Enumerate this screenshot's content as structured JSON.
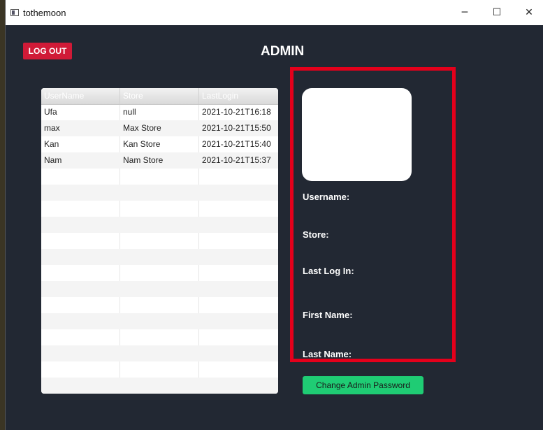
{
  "window": {
    "title": "tothemoon",
    "minimize_glyph": "─",
    "maximize_glyph": "☐",
    "close_glyph": "✕"
  },
  "header": {
    "logout_label": "LOG OUT",
    "page_title": "ADMIN"
  },
  "table": {
    "columns": [
      "UserName",
      "Store",
      "LastLogin"
    ],
    "rows": [
      [
        "Ufa",
        "null",
        "2021-10-21T16:18"
      ],
      [
        "max",
        "Max Store",
        "2021-10-21T15:50"
      ],
      [
        "Kan",
        "Kan Store",
        "2021-10-21T15:40"
      ],
      [
        "Nam",
        "Nam Store",
        "2021-10-21T15:37"
      ]
    ]
  },
  "details": {
    "username_label": "Username:",
    "store_label": "Store:",
    "last_login_label": "Last Log In:",
    "first_name_label": "First Name:",
    "last_name_label": "Last Name:"
  },
  "actions": {
    "change_password_label": "Change Admin Password"
  },
  "colors": {
    "background": "#222833",
    "logout": "#d01a37",
    "highlight_border": "#e4001b",
    "change_password": "#1fcc74"
  }
}
